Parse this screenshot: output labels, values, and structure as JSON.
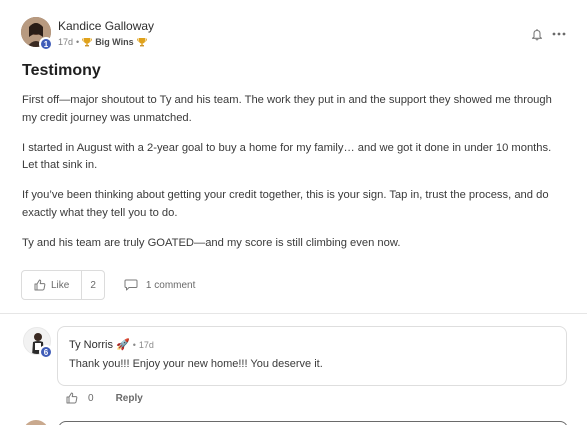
{
  "post": {
    "author": "Kandice Galloway",
    "level": "1",
    "time": "17d",
    "separator": "•",
    "badge": "Big Wins",
    "title": "Testimony",
    "paragraphs": [
      "First off—major shoutout to Ty and his team. The work they put in and the support they showed me through my credit journey was unmatched.",
      "I started in August with a 2-year goal to buy a home for my family… and we got it done in under 10 months. Let that sink in.",
      "If you’ve been thinking about getting your credit together, this is your sign. Tap in, trust the process, and do exactly what they tell you to do.",
      "Ty and his team are truly GOATED—and my score is still climbing even now."
    ],
    "like_label": "Like",
    "like_count": "2",
    "comment_label": "1 comment"
  },
  "comment": {
    "author": "Ty Norris",
    "author_emoji": "🚀",
    "level": "6",
    "separator": "•",
    "time": "17d",
    "text": "Thank you!!! Enjoy your new home!!! You deserve it.",
    "like_count": "0",
    "reply_label": "Reply"
  },
  "icons": {
    "bell": "bell-icon",
    "more": "more-icon",
    "like": "thumbs-up-icon",
    "comment": "speech-bubble-icon",
    "trophy": "trophy-icon"
  },
  "colors": {
    "level_badge": "#3f5cb8",
    "trophy": "#e0a21b"
  }
}
